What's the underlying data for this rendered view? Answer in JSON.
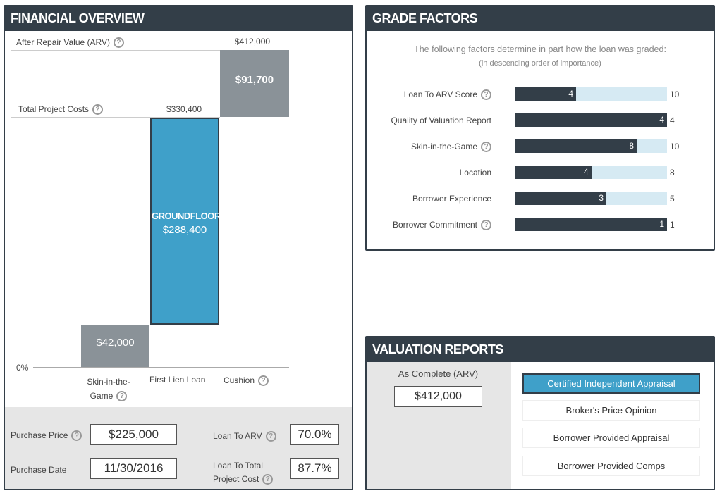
{
  "financial": {
    "title": "FINANCIAL OVERVIEW",
    "arv_label": "After Repair Value (ARV)",
    "arv_value": "$412,000",
    "tpc_label": "Total Project Costs",
    "tpc_value": "$330,400",
    "cushion_value": "$91,700",
    "loan_brand": "GROUNDFLOOR",
    "loan_value": "$288,400",
    "skin_value": "$42,000",
    "zero_label": "0%",
    "cat_skin_1": "Skin-in-the-",
    "cat_skin_2": "Game",
    "cat_loan": "First Lien Loan",
    "cat_cushion": "Cushion",
    "purchase_price_label": "Purchase Price",
    "purchase_price": "$225,000",
    "purchase_date_label": "Purchase Date",
    "purchase_date": "11/30/2016",
    "ltarv_label": "Loan To ARV",
    "ltarv": "70.0%",
    "ltpc_label_1": "Loan To Total",
    "ltpc_label_2": "Project Cost",
    "ltpc": "87.7%",
    "colors": {
      "loan": "#3fa0c9",
      "cushion": "#8a9298",
      "skin": "#8a9298"
    }
  },
  "grade": {
    "title": "GRADE FACTORS",
    "intro": "The following factors determine in part how the loan was graded:",
    "sub": "(in descending order of importance)",
    "factors": [
      {
        "label": "Loan To ARV Score",
        "score": 4,
        "max": 10,
        "help": true
      },
      {
        "label": "Quality of Valuation Report",
        "score": 4,
        "max": 4,
        "help": false
      },
      {
        "label": "Skin-in-the-Game",
        "score": 8,
        "max": 10,
        "help": true
      },
      {
        "label": "Location",
        "score": 4,
        "max": 8,
        "help": false
      },
      {
        "label": "Borrower Experience",
        "score": 3,
        "max": 5,
        "help": false
      },
      {
        "label": "Borrower Commitment",
        "score": 1,
        "max": 1,
        "help": true
      }
    ]
  },
  "valuation": {
    "title": "VALUATION REPORTS",
    "as_complete_label": "As Complete (ARV)",
    "as_complete_value": "$412,000",
    "options": [
      "Certified Independent Appraisal",
      "Broker's Price Opinion",
      "Borrower Provided Appraisal",
      "Borrower Provided Comps"
    ],
    "selected": "Certified Independent Appraisal"
  },
  "help_glyph": "?"
}
